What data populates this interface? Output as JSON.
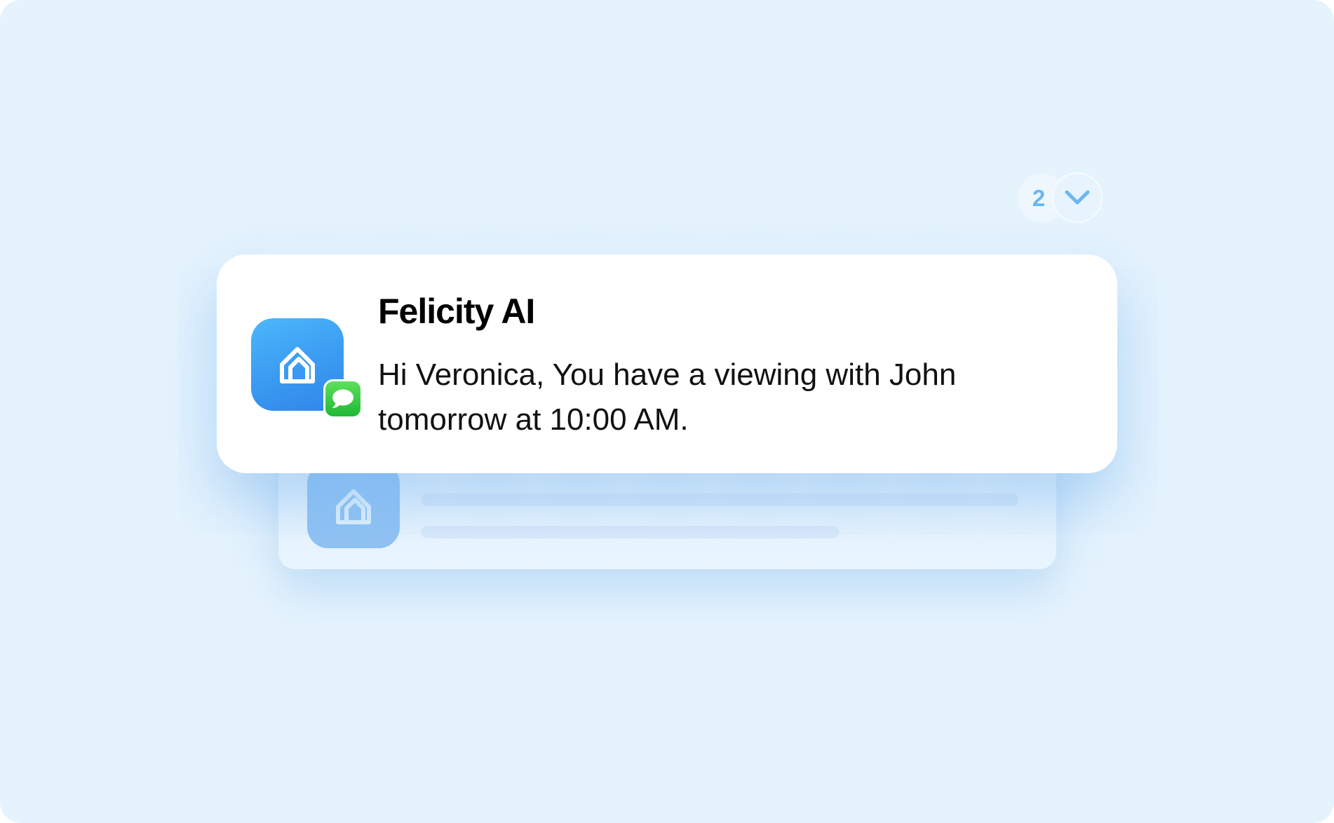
{
  "notification_stack": {
    "count": "2",
    "expand_icon": "chevron-down-icon"
  },
  "notification": {
    "app_name": "Felicity AI",
    "app_icon": "home-icon",
    "badge_icon": "messages-icon",
    "message": "Hi Veronica, You have a viewing with John tomorrow at 10:00 AM."
  },
  "colors": {
    "background": "#e5f3fd",
    "app_icon_blue": "#3a9af1",
    "messages_green": "#1fb835",
    "accent_light_blue": "#6db6f1"
  }
}
